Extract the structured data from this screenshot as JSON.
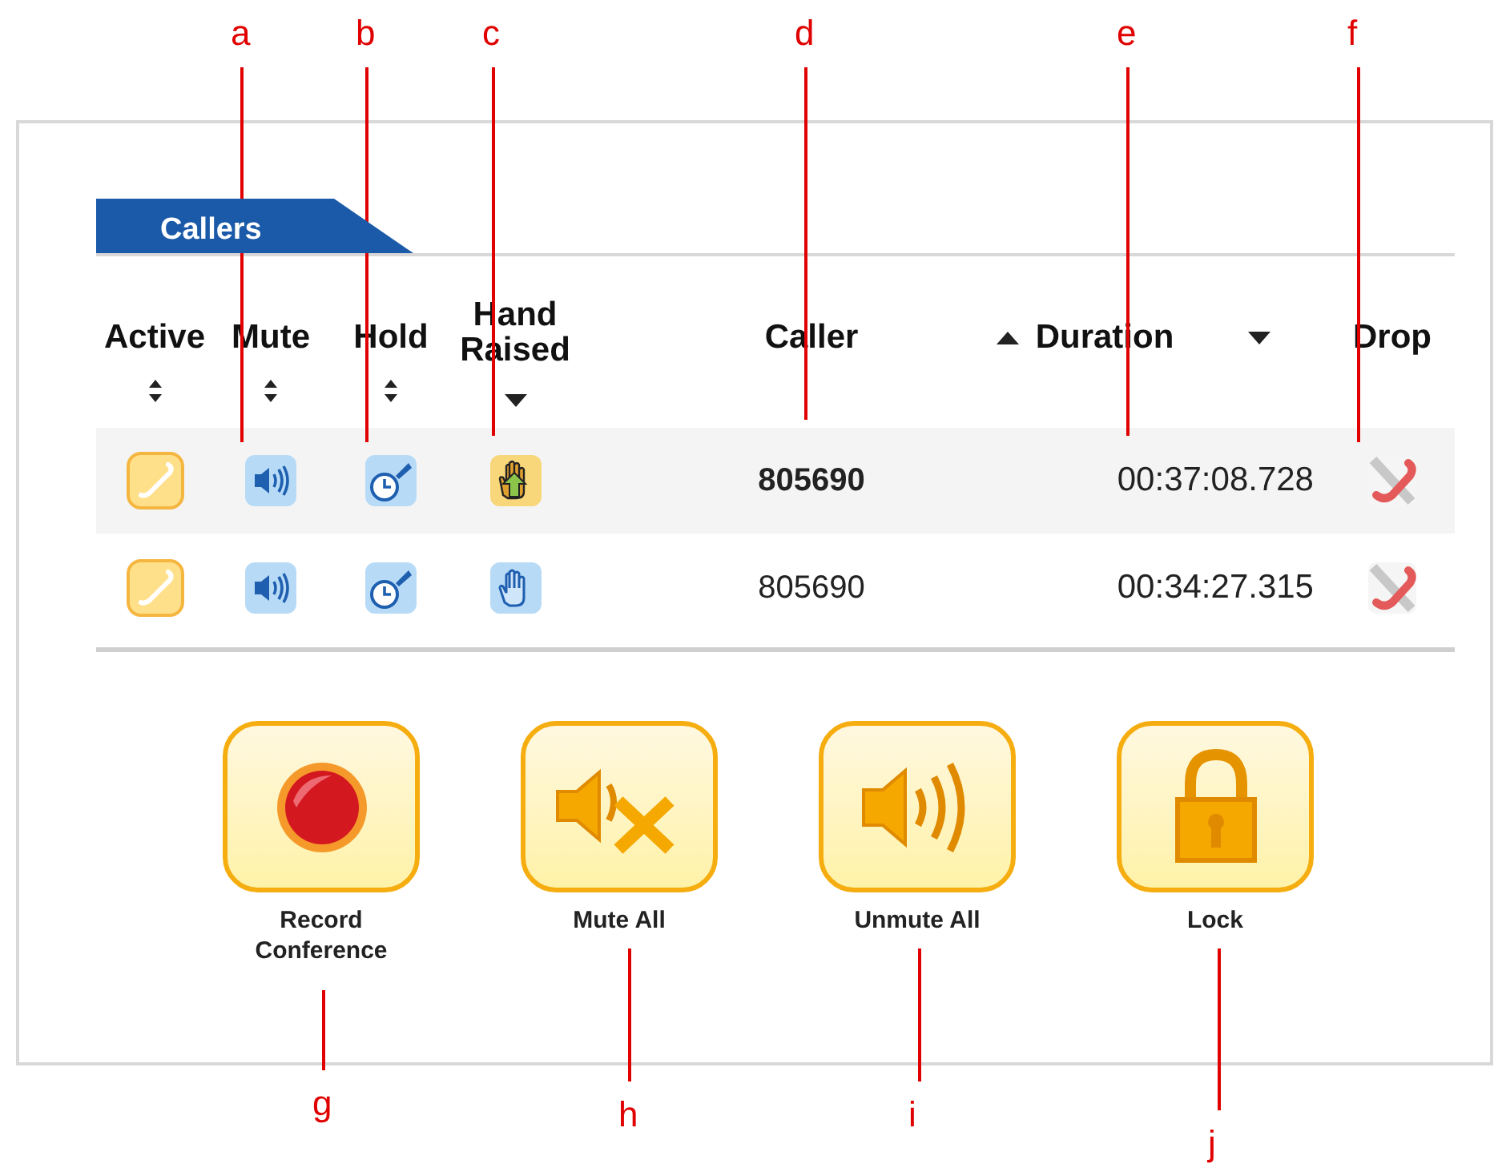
{
  "callouts_top": [
    {
      "label": "a"
    },
    {
      "label": "b"
    },
    {
      "label": "c"
    },
    {
      "label": "d"
    },
    {
      "label": "e"
    },
    {
      "label": "f"
    }
  ],
  "tabs": [
    {
      "label": "Callers",
      "selected": true
    }
  ],
  "columns": [
    {
      "label": "Active",
      "kind": "stacked",
      "sort_up": true,
      "sort_down": true
    },
    {
      "label": "Mute",
      "kind": "stacked",
      "sort_up": true,
      "sort_down": true
    },
    {
      "label": "Hold",
      "kind": "stacked",
      "sort_up": true,
      "sort_down": true
    },
    {
      "label": "Hand Raised",
      "kind": "stacked",
      "sort_down": true
    },
    {
      "label": "Caller",
      "kind": "stacked"
    },
    {
      "label": "Duration",
      "kind": "split",
      "sort_up": true,
      "sort_down": true
    },
    {
      "label": "Drop",
      "kind": "stacked"
    }
  ],
  "rows": [
    {
      "caller": "805690",
      "duration": "00:37:08.728",
      "hand_raised": true,
      "selected": true
    },
    {
      "caller": "805690",
      "duration": "00:34:27.315",
      "hand_raised": false,
      "selected": false
    }
  ],
  "actions": [
    {
      "kind": "record",
      "label": "Record Conference"
    },
    {
      "kind": "mute_all",
      "label": "Mute All"
    },
    {
      "kind": "unmute_all",
      "label": "Unmute All"
    },
    {
      "kind": "lock",
      "label": "Lock"
    }
  ],
  "callouts_bottom": [
    {
      "label": "g"
    },
    {
      "label": "h"
    },
    {
      "label": "i"
    },
    {
      "label": "j"
    }
  ]
}
